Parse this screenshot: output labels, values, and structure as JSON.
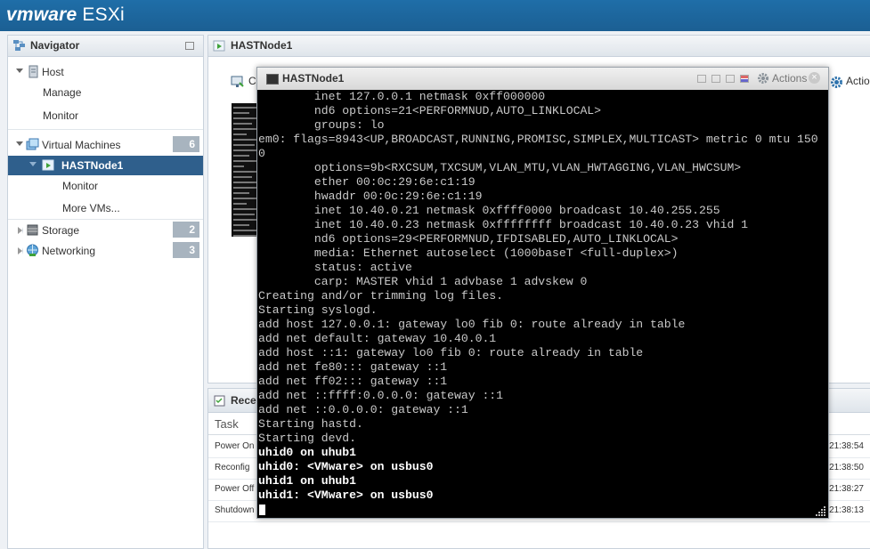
{
  "brand": {
    "vm": "vmware",
    "product": "ESXi"
  },
  "navigator": {
    "title": "Navigator",
    "items": [
      {
        "label": "Host"
      },
      {
        "label": "Manage"
      },
      {
        "label": "Monitor"
      },
      {
        "label": "Virtual Machines",
        "count": "6"
      },
      {
        "label": "HASTNode1"
      },
      {
        "label": "Monitor"
      },
      {
        "label": "More VMs..."
      },
      {
        "label": "Storage",
        "count": "2"
      },
      {
        "label": "Networking",
        "count": "3"
      }
    ]
  },
  "vm_panel": {
    "title": "HASTNode1",
    "toolbar_first": "C",
    "actions_label": "Actio"
  },
  "recent_tasks": {
    "title": "Rece",
    "column": "Task",
    "rows": [
      {
        "task": "Power On",
        "time": "21:38:54"
      },
      {
        "task": "Reconfig",
        "time": "21:38:50"
      },
      {
        "task": "Power Off",
        "time": "21:38:27"
      },
      {
        "task": "Shutdown",
        "time": "21:38:13"
      }
    ]
  },
  "console": {
    "title": "HASTNode1",
    "actions_label": "Actions",
    "close_glyph": "×",
    "lines": [
      "        inet 127.0.0.1 netmask 0xff000000",
      "        nd6 options=21<PERFORMNUD,AUTO_LINKLOCAL>",
      "        groups: lo",
      "em0: flags=8943<UP,BROADCAST,RUNNING,PROMISC,SIMPLEX,MULTICAST> metric 0 mtu 150",
      "0",
      "        options=9b<RXCSUM,TXCSUM,VLAN_MTU,VLAN_HWTAGGING,VLAN_HWCSUM>",
      "        ether 00:0c:29:6e:c1:19",
      "        hwaddr 00:0c:29:6e:c1:19",
      "        inet 10.40.0.21 netmask 0xffff0000 broadcast 10.40.255.255",
      "        inet 10.40.0.23 netmask 0xffffffff broadcast 10.40.0.23 vhid 1",
      "        nd6 options=29<PERFORMNUD,IFDISABLED,AUTO_LINKLOCAL>",
      "        media: Ethernet autoselect (1000baseT <full-duplex>)",
      "        status: active",
      "        carp: MASTER vhid 1 advbase 1 advskew 0",
      "Creating and/or trimming log files.",
      "Starting syslogd.",
      "add host 127.0.0.1: gateway lo0 fib 0: route already in table",
      "add net default: gateway 10.40.0.1",
      "add host ::1: gateway lo0 fib 0: route already in table",
      "add net fe80::: gateway ::1",
      "add net ff02::: gateway ::1",
      "add net ::ffff:0.0.0.0: gateway ::1",
      "add net ::0.0.0.0: gateway ::1",
      "Starting hastd.",
      "Starting devd."
    ],
    "bold_lines": [
      "uhid0 on uhub1",
      "uhid0: <VMware> on usbus0",
      "uhid1 on uhub1",
      "uhid1: <VMware> on usbus0"
    ]
  }
}
